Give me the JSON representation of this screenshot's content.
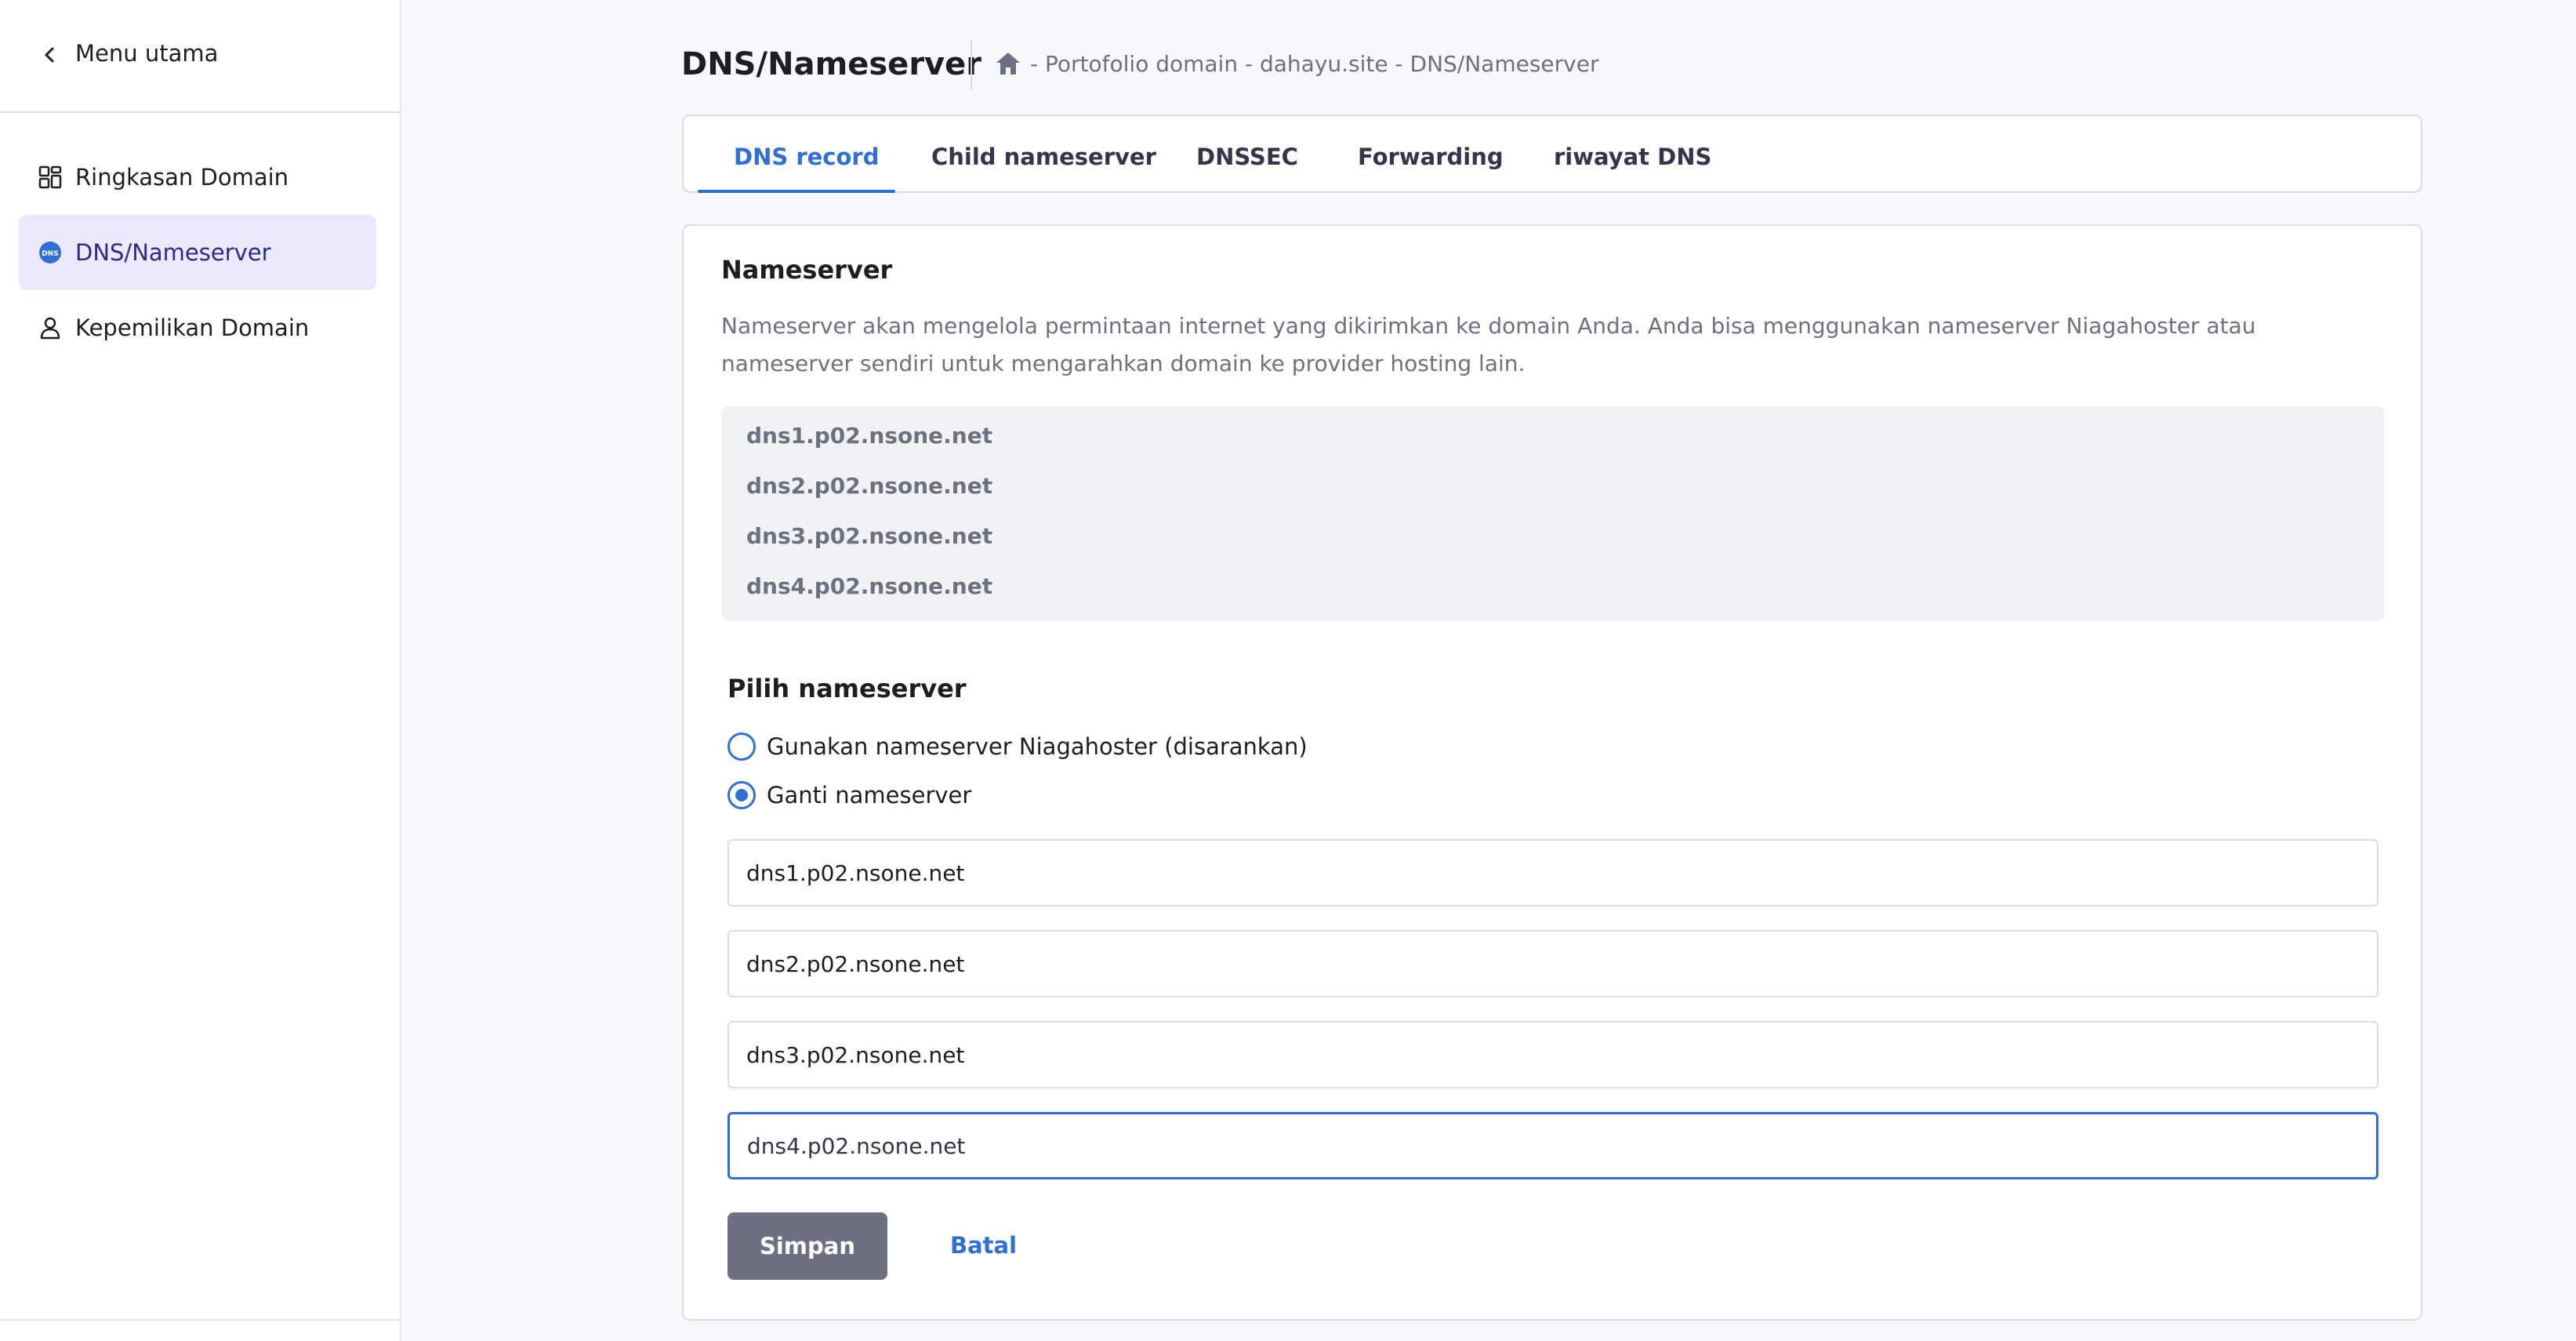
{
  "sidebar": {
    "back_label": "Menu utama",
    "items": [
      {
        "label": "Ringkasan Domain",
        "icon": "grid-icon",
        "active": false
      },
      {
        "label": "DNS/Nameserver",
        "icon": "dns-icon",
        "active": true
      },
      {
        "label": "Kepemilikan Domain",
        "icon": "user-icon",
        "active": false
      }
    ]
  },
  "header": {
    "title": "DNS/Nameserver",
    "breadcrumb": "- Portofolio domain - dahayu.site - DNS/Nameserver"
  },
  "tabs": [
    {
      "label": "DNS record",
      "active": true
    },
    {
      "label": "Child nameserver",
      "active": false
    },
    {
      "label": "DNSSEC",
      "active": false
    },
    {
      "label": "Forwarding",
      "active": false
    },
    {
      "label": "riwayat DNS",
      "active": false
    }
  ],
  "card": {
    "title": "Nameserver",
    "description": "Nameserver akan mengelola permintaan internet yang dikirimkan ke domain Anda. Anda bisa menggunakan nameserver Niagahoster atau nameserver sendiri untuk mengarahkan domain ke provider hosting lain.",
    "current_nameservers": [
      "dns1.p02.nsone.net",
      "dns2.p02.nsone.net",
      "dns3.p02.nsone.net",
      "dns4.p02.nsone.net"
    ],
    "choose_title": "Pilih nameserver",
    "options": [
      {
        "label": "Gunakan nameserver Niagahoster (disarankan)",
        "checked": false
      },
      {
        "label": "Ganti nameserver",
        "checked": true
      }
    ],
    "inputs": [
      "dns1.p02.nsone.net",
      "dns2.p02.nsone.net",
      "dns3.p02.nsone.net",
      "dns4.p02.nsone.net"
    ],
    "save_label": "Simpan",
    "cancel_label": "Batal"
  },
  "colors": {
    "accent": "#2f6fd6",
    "active_nav_bg": "#ebe9fb",
    "save_button": "#6d7081"
  }
}
